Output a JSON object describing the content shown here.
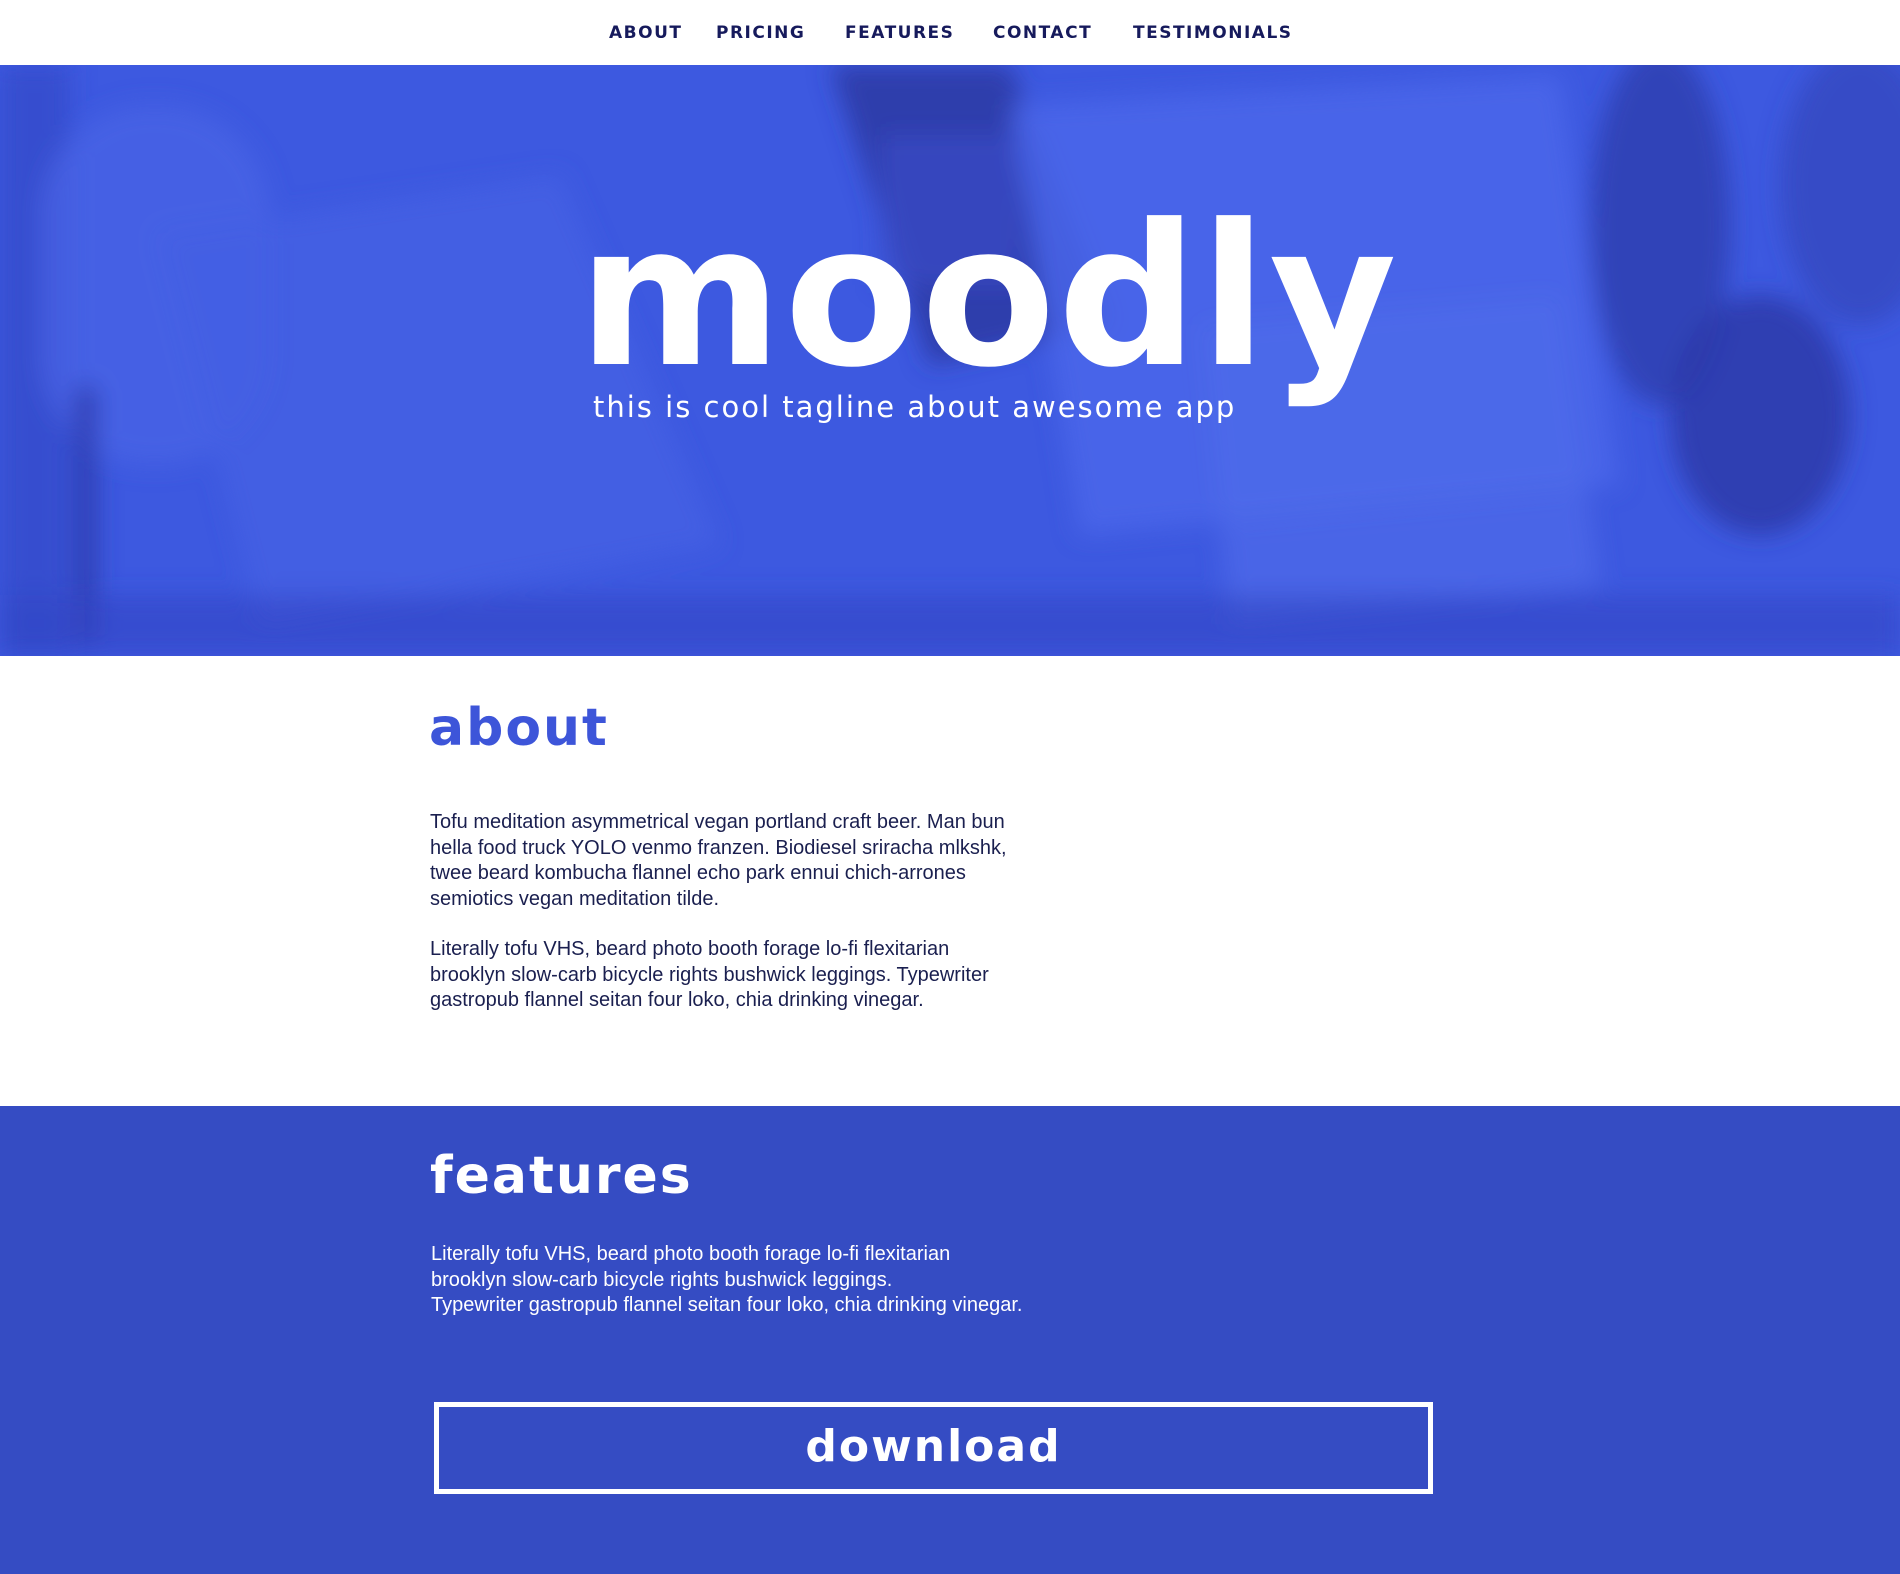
{
  "colors": {
    "nav_text": "#161a5c",
    "hero_bg": "#3d59e0",
    "about_heading": "#3d55d9",
    "body_text": "#1a1f4f",
    "features_bg": "#354cc3"
  },
  "nav": {
    "items": [
      {
        "label": "ABOUT"
      },
      {
        "label": "PRICING"
      },
      {
        "label": "FEATURES"
      },
      {
        "label": "CONTACT"
      },
      {
        "label": "TESTIMONIALS"
      }
    ]
  },
  "hero": {
    "title": "moodly",
    "tagline": "this is cool tagline about awesome app"
  },
  "about": {
    "heading": "about",
    "paragraphs": [
      "Tofu meditation asymmetrical vegan portland craft beer. Man bun hella food truck YOLO venmo franzen. Biodiesel sriracha mlkshk, twee beard kombucha flannel echo park ennui chich-arrones semiotics vegan meditation tilde.",
      "Literally tofu VHS, beard photo booth forage lo-fi flexitarian brooklyn slow-carb bicycle rights bushwick leggings. Typewriter gastropub flannel seitan four loko, chia drinking vinegar."
    ]
  },
  "features": {
    "heading": "features",
    "text": "Literally tofu VHS, beard photo booth forage lo-fi flexitarian\nbrooklyn slow-carb bicycle rights bushwick leggings.\nTypewriter gastropub flannel seitan four loko, chia drinking vinegar.",
    "download_label": "download"
  }
}
